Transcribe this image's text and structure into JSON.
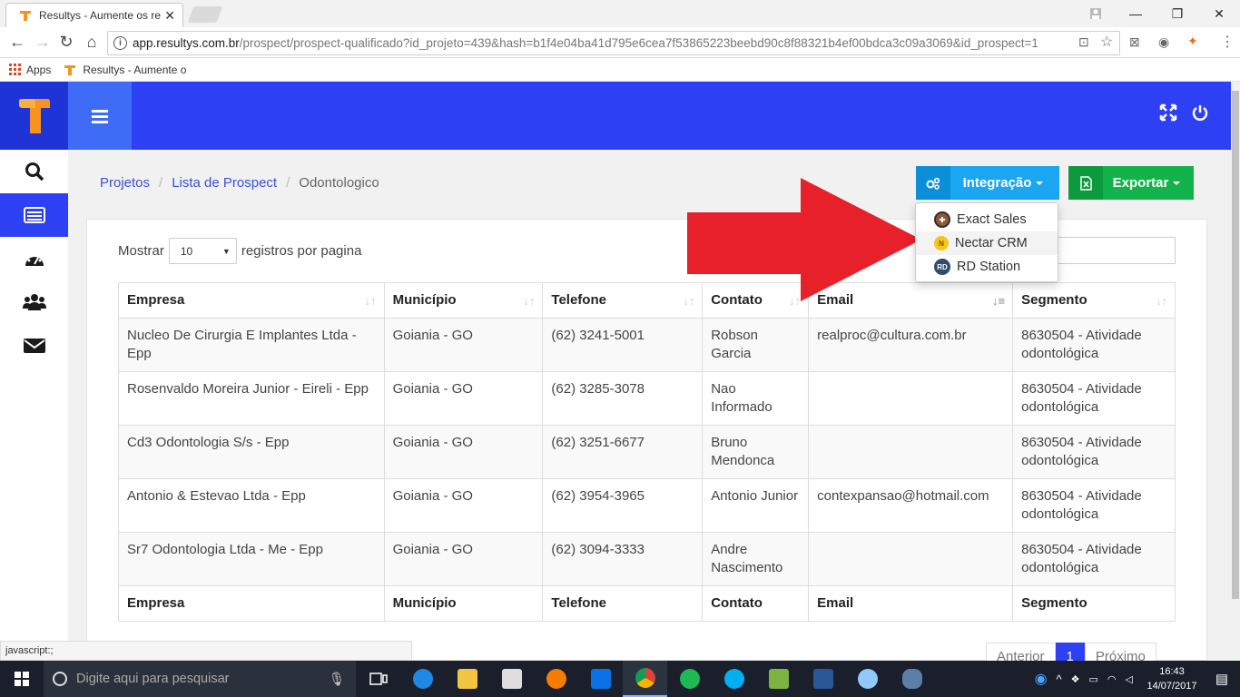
{
  "browser": {
    "tab_title": "Resultys - Aumente os re",
    "tab_close": "✕",
    "url_host": "app.resultys.com.br",
    "url_path": "/prospect/prospect-qualificado?id_projeto=439&hash=b1f4e04ba41d795e6cea7f53865223beebd90c8f88321b4ef00bdca3c09a3069&id_prospect=1",
    "bookmark_apps": "Apps",
    "bookmark_resultys": "Resultys - Aumente o",
    "status_text": "javascript:;"
  },
  "breadcrumb": {
    "items": [
      "Projetos",
      "Lista de Prospect",
      "Odontologico"
    ]
  },
  "actions": {
    "integration_label": "Integração",
    "export_label": "Exportar"
  },
  "dropdown": {
    "items": [
      {
        "label": "Exact Sales",
        "icon": "exact-sales-logo"
      },
      {
        "label": "Nectar CRM",
        "icon": "nectar-crm-logo"
      },
      {
        "label": "RD Station",
        "icon": "rd-station-logo"
      }
    ]
  },
  "table_controls": {
    "show_label": "Mostrar",
    "page_size": "10",
    "per_page_label": "registros por pagina"
  },
  "table": {
    "headers": [
      "Empresa",
      "Município",
      "Telefone",
      "Contato",
      "Email",
      "Segmento"
    ],
    "rows": [
      [
        "Nucleo De Cirurgia E Implantes Ltda - Epp",
        "Goiania - GO",
        "(62) 3241-5001",
        "Robson Garcia",
        "realproc@cultura.com.br",
        "8630504 - Atividade odontológica"
      ],
      [
        "Rosenvaldo Moreira Junior - Eireli - Epp",
        "Goiania - GO",
        "(62) 3285-3078",
        "Nao Informado",
        "",
        "8630504 - Atividade odontológica"
      ],
      [
        "Cd3 Odontologia S/s - Epp",
        "Goiania - GO",
        "(62) 3251-6677",
        "Bruno Mendonca",
        "",
        "8630504 - Atividade odontológica"
      ],
      [
        "Antonio & Estevao Ltda - Epp",
        "Goiania - GO",
        "(62) 3954-3965",
        "Antonio Junior",
        "contexpansao@hotmail.com",
        "8630504 - Atividade odontológica"
      ],
      [
        "Sr7 Odontologia Ltda - Me - Epp",
        "Goiania - GO",
        "(62) 3094-3333",
        "Andre Nascimento",
        "",
        "8630504 - Atividade odontológica"
      ]
    ]
  },
  "pagination": {
    "prev": "Anterior",
    "current": "1",
    "next": "Próximo"
  },
  "taskbar": {
    "search_placeholder": "Digite aqui para pesquisar",
    "time": "16:43",
    "date": "14/07/2017"
  },
  "colors": {
    "header": "#2d40f3",
    "integration": "#1aa6f0",
    "export": "#12b34a",
    "arrow": "#e8202a"
  }
}
